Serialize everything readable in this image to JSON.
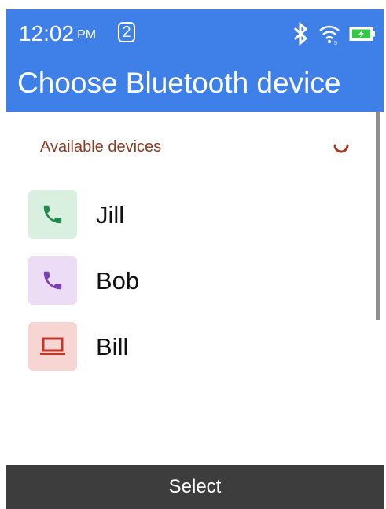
{
  "status_bar": {
    "time": "12:02",
    "ampm": "PM",
    "notification_count": "2",
    "icons": [
      "bluetooth-icon",
      "wifi-icon",
      "battery-charging-icon"
    ]
  },
  "header": {
    "title": "Choose Bluetooth device"
  },
  "section": {
    "label": "Available devices",
    "status_icon": "loading-spinner-icon"
  },
  "devices": [
    {
      "name": "Jill",
      "icon": "phone-icon",
      "color": "#1e8a4c",
      "bg": "#d9efe0"
    },
    {
      "name": "Bob",
      "icon": "phone-icon",
      "color": "#7a3fb3",
      "bg": "#ecdcf5"
    },
    {
      "name": "Bill",
      "icon": "laptop-icon",
      "color": "#c0392b",
      "bg": "#f7d5d2"
    }
  ],
  "softkeys": {
    "center": "Select"
  },
  "colors": {
    "header_bg": "#3f7fe8",
    "section_label": "#8a3a22",
    "softkey_bg": "#3d3d3d"
  }
}
